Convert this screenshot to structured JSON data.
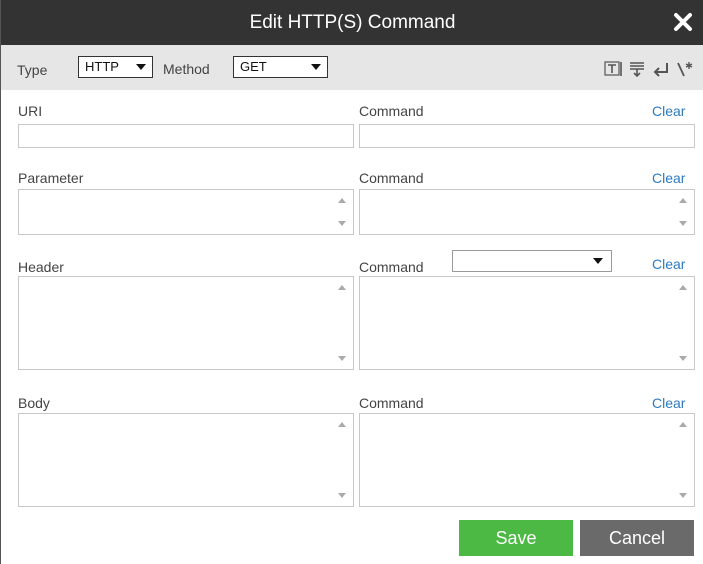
{
  "dialog": {
    "title": "Edit HTTP(S) Command",
    "close_icon": "close-icon"
  },
  "toolbar": {
    "type_label": "Type",
    "type_value": "HTTP",
    "method_label": "Method",
    "method_value": "GET",
    "icons": [
      "text-format-icon",
      "insert-below-icon",
      "return-icon",
      "regex-icon"
    ]
  },
  "sections": {
    "uri": {
      "label": "URI",
      "command_label": "Command",
      "clear_label": "Clear"
    },
    "parameter": {
      "label": "Parameter",
      "command_label": "Command",
      "clear_label": "Clear"
    },
    "header": {
      "label": "Header",
      "command_label": "Command",
      "command_select_value": "",
      "clear_label": "Clear"
    },
    "body": {
      "label": "Body",
      "command_label": "Command",
      "clear_label": "Clear"
    }
  },
  "footer": {
    "save_label": "Save",
    "cancel_label": "Cancel"
  },
  "colors": {
    "titlebar": "#333333",
    "toolbar": "#e6e6e6",
    "link": "#2d7bbf",
    "save": "#4cb944",
    "cancel": "#6a6a6a"
  }
}
